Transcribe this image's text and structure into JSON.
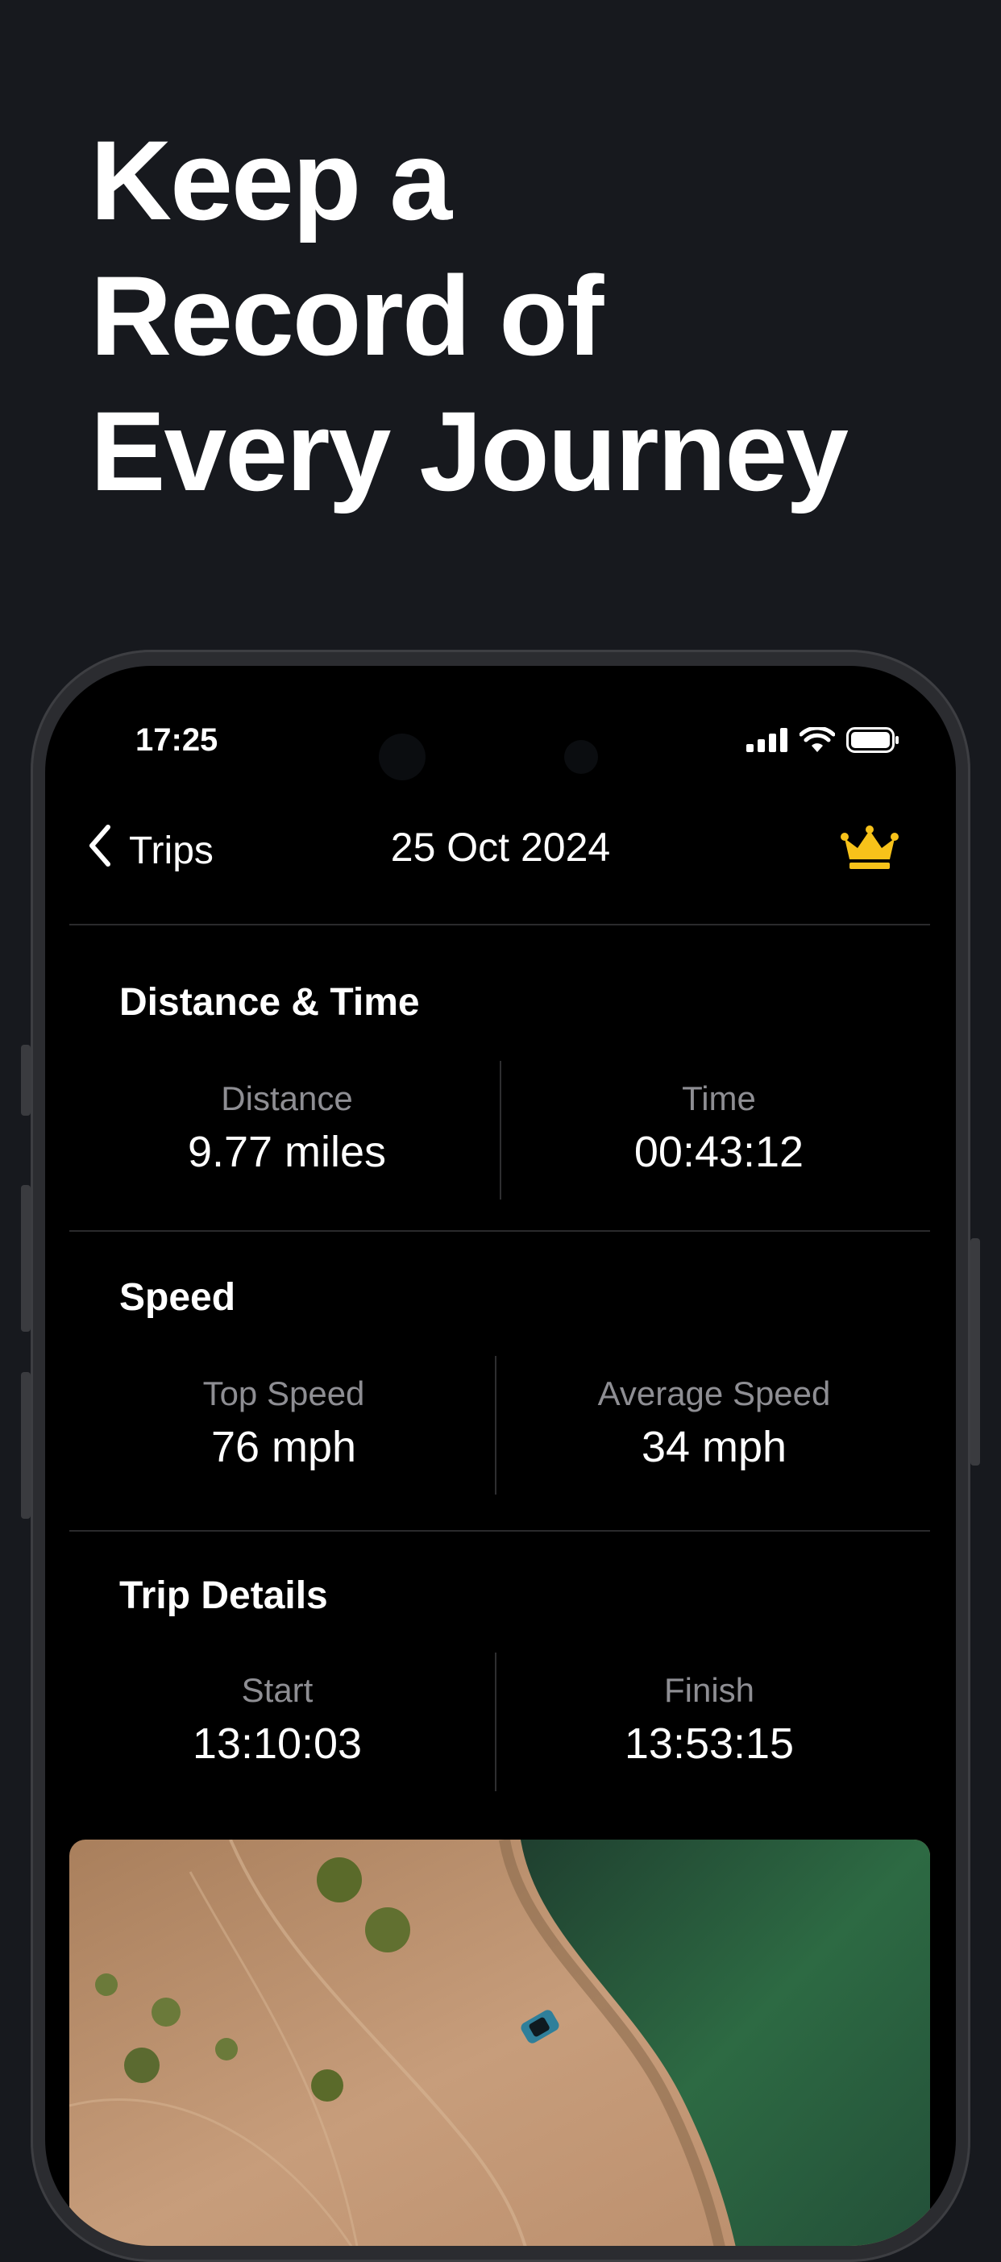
{
  "headline": {
    "line1": "Keep a",
    "line2": "Record of",
    "line3": "Every Journey"
  },
  "status_bar": {
    "time": "17:25"
  },
  "nav": {
    "back_label": "Trips",
    "title": "25 Oct 2024"
  },
  "sections": {
    "distance_time": {
      "title": "Distance & Time",
      "left": {
        "label": "Distance",
        "value": "9.77 miles"
      },
      "right": {
        "label": "Time",
        "value": "00:43:12"
      }
    },
    "speed": {
      "title": "Speed",
      "left": {
        "label": "Top Speed",
        "value": "76 mph"
      },
      "right": {
        "label": "Average Speed",
        "value": "34 mph"
      }
    },
    "trip_details": {
      "title": "Trip Details",
      "left": {
        "label": "Start",
        "value": "13:10:03"
      },
      "right": {
        "label": "Finish",
        "value": "13:53:15"
      }
    }
  },
  "icons": {
    "back": "chevron-left-icon",
    "premium": "crown-icon",
    "signal": "signal-icon",
    "wifi": "wifi-icon",
    "battery": "battery-icon"
  },
  "colors": {
    "background": "#17191e",
    "crown": "#f7c21a",
    "muted_text": "#8e8e93"
  }
}
